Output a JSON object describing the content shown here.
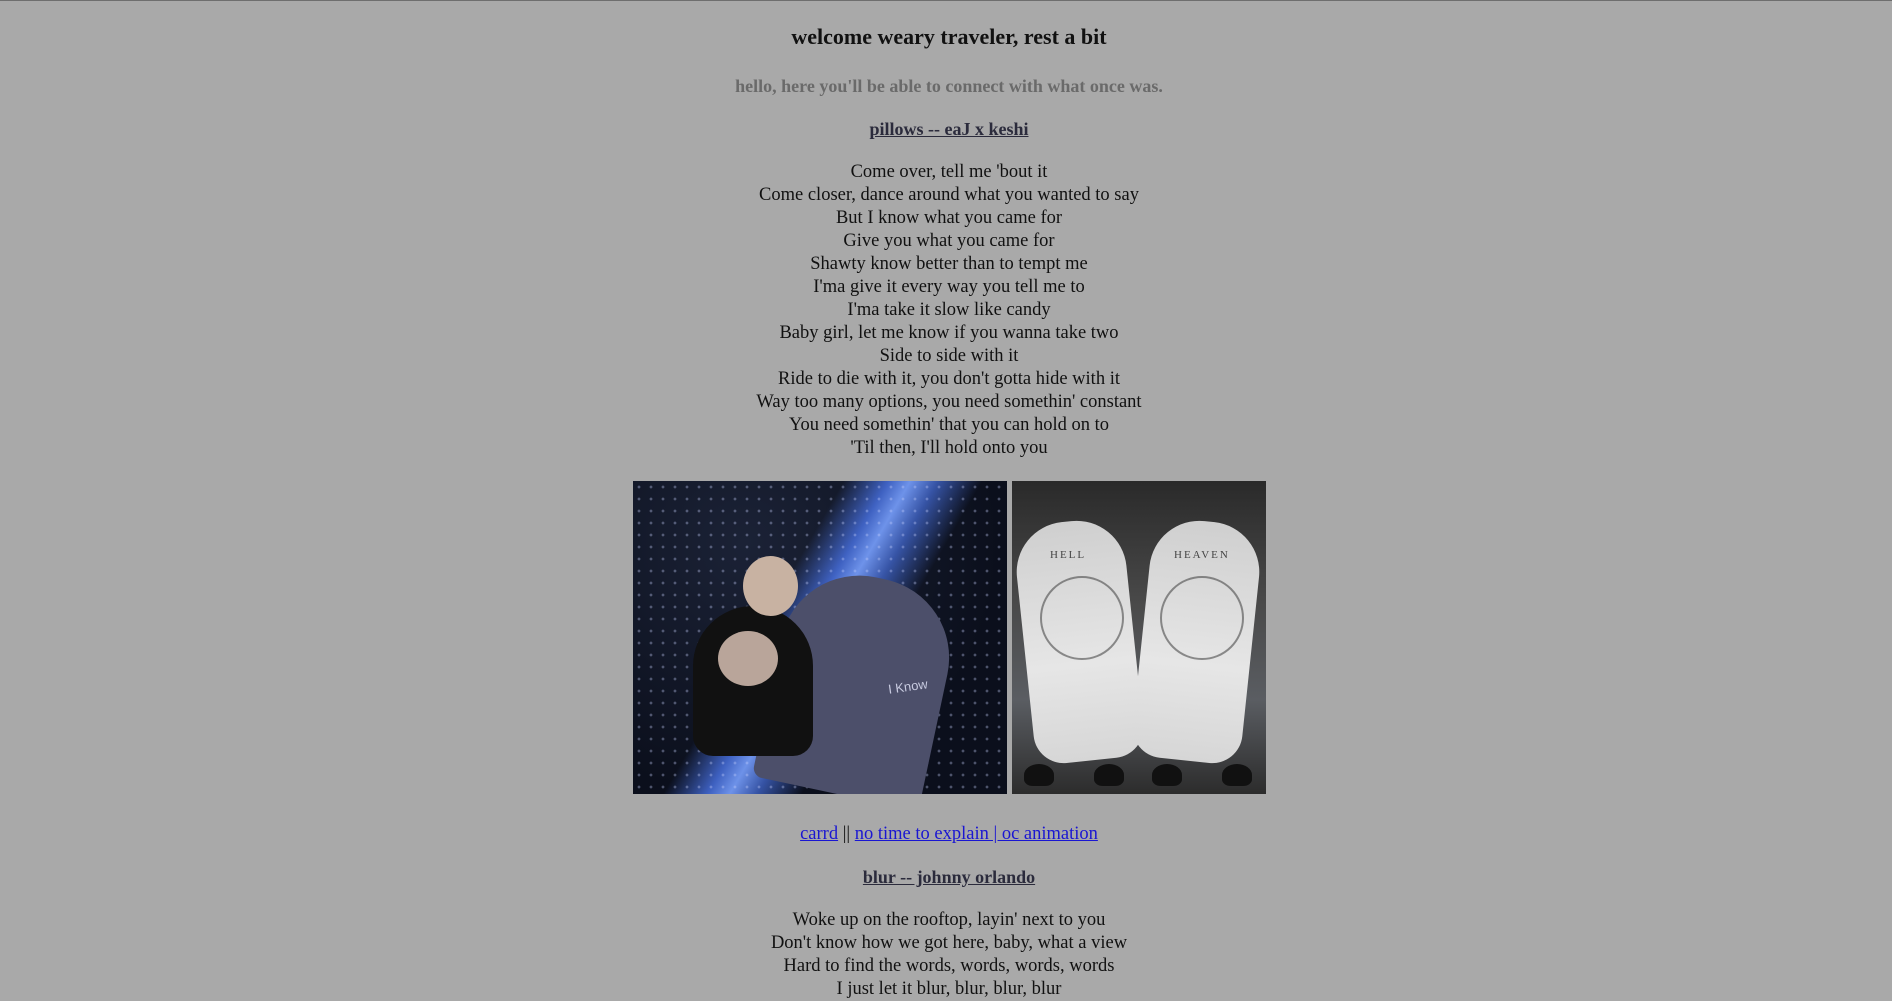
{
  "header": {
    "title": "welcome weary traveler, rest a bit",
    "subtitle": "hello, here you'll be able to connect with what once was."
  },
  "songs": [
    {
      "title": "pillows -- eaJ x keshi",
      "lyrics": [
        "Come over, tell me 'bout it",
        "Come closer, dance around what you wanted to say",
        "But I know what you came for",
        "Give you what you came for",
        "Shawty know better than to tempt me",
        "I'ma give it every way you tell me to",
        "I'ma take it slow like candy",
        "Baby girl, let me know if you wanna take two",
        "Side to side with it",
        "Ride to die with it, you don't gotta hide with it",
        "Way too many options, you need somethin' constant",
        "You need somethin' that you can hold on to",
        "'Til then, I'll hold onto you"
      ]
    },
    {
      "title": "blur -- johnny orlando",
      "lyrics": [
        "Woke up on the rooftop, layin' next to you",
        "Don't know how we got here, baby, what a view",
        "Hard to find the words, words, words, words",
        "I just let it blur, blur, blur, blur"
      ]
    }
  ],
  "photos": {
    "tattoo_left_text": "HELL",
    "tattoo_right_text": "HEAVEN",
    "jacket_text": "I Know"
  },
  "links": {
    "carrd": "carrd",
    "separator": "||",
    "animation": "no time to explain | oc animation"
  },
  "colors": {
    "background": "#a9a9a9",
    "link": "#1a16d2",
    "song_title": "#2b2b3c",
    "subtitle": "#6a6a6a"
  }
}
